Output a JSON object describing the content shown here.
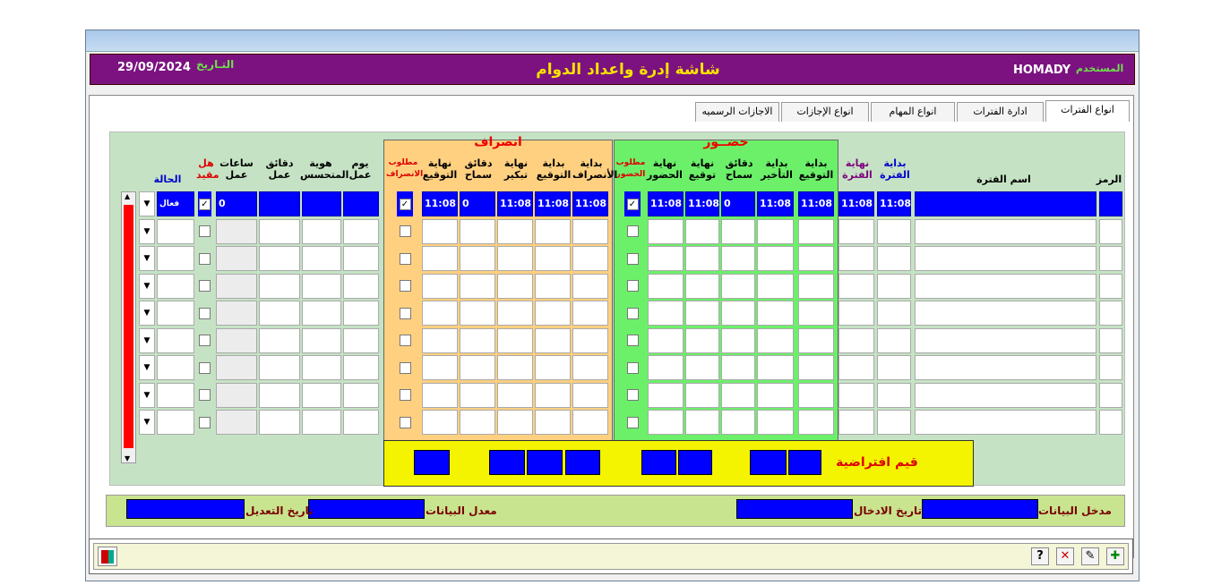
{
  "header": {
    "title": "شاشة إدرة واعداد الدوام",
    "date_label": "التـاريخ",
    "date": "29/09/2024",
    "user_label": "المستخدم",
    "user": "HOMADY"
  },
  "tabs": [
    "انواع الفترات",
    "ادارة الفترات",
    "انواع المهام",
    "انواع الإجازات",
    "الاجازات الرسميه"
  ],
  "groups": {
    "attend": "حضــور",
    "leave": "انصراف"
  },
  "columns": {
    "code": "الرمز",
    "name": "اسم الفترة",
    "period_start": "بداية الفترة",
    "period_end": "نهاية الفترة",
    "sign_start": "بداية التوقيع",
    "late_start": "بداية التأخير",
    "grace_min": "دقائق سماح",
    "attend_sign_end": "نهاية توقيع",
    "attend_end": "نهاية الحضور",
    "req_attend": "مطلوب الحضور",
    "leave_start": "بداية الأنصراف",
    "leave_sign": "بداية التوقيع",
    "early_end": "نهاية تبكير",
    "leave_grace": "دقائق سماح",
    "leave_sign_end": "نهاية التوقيع",
    "req_leave": "مطلوب الانصراف",
    "workday": "يوم عمل",
    "spec_id": "هوية المتحسس",
    "work_min": "دقائق عمل",
    "work_hours": "ساعات عمل",
    "restricted": "هل مقيد",
    "status": "الحالة"
  },
  "row1": {
    "period_start": "11:08",
    "period_end": "11:08",
    "sign_start": "11:08",
    "late_start": "11:08",
    "grace_min": "0",
    "attend_sign_end": "11:08",
    "attend_end": "11:08",
    "leave_start": "11:08",
    "leave_sign": "11:08",
    "early_end": "11:08",
    "leave_grace": "0",
    "leave_sign_end": "11:08",
    "work_hours": "0",
    "status": "فعال"
  },
  "defaults_label": "قيم افتراضية",
  "bottom": {
    "entry_user": "مدخل البيانات",
    "entry_date": "تاريخ الادخال",
    "editor": "معدل البيانات",
    "edit_date": "تاريخ التعديل"
  },
  "colors": {
    "header_bg": "#7b1280",
    "title": "#f8e200",
    "cell_blue": "#0000ff",
    "attend_bg": "#6cf06a",
    "leave_bg": "#ffd080",
    "defaults_bg": "#f4f400"
  }
}
